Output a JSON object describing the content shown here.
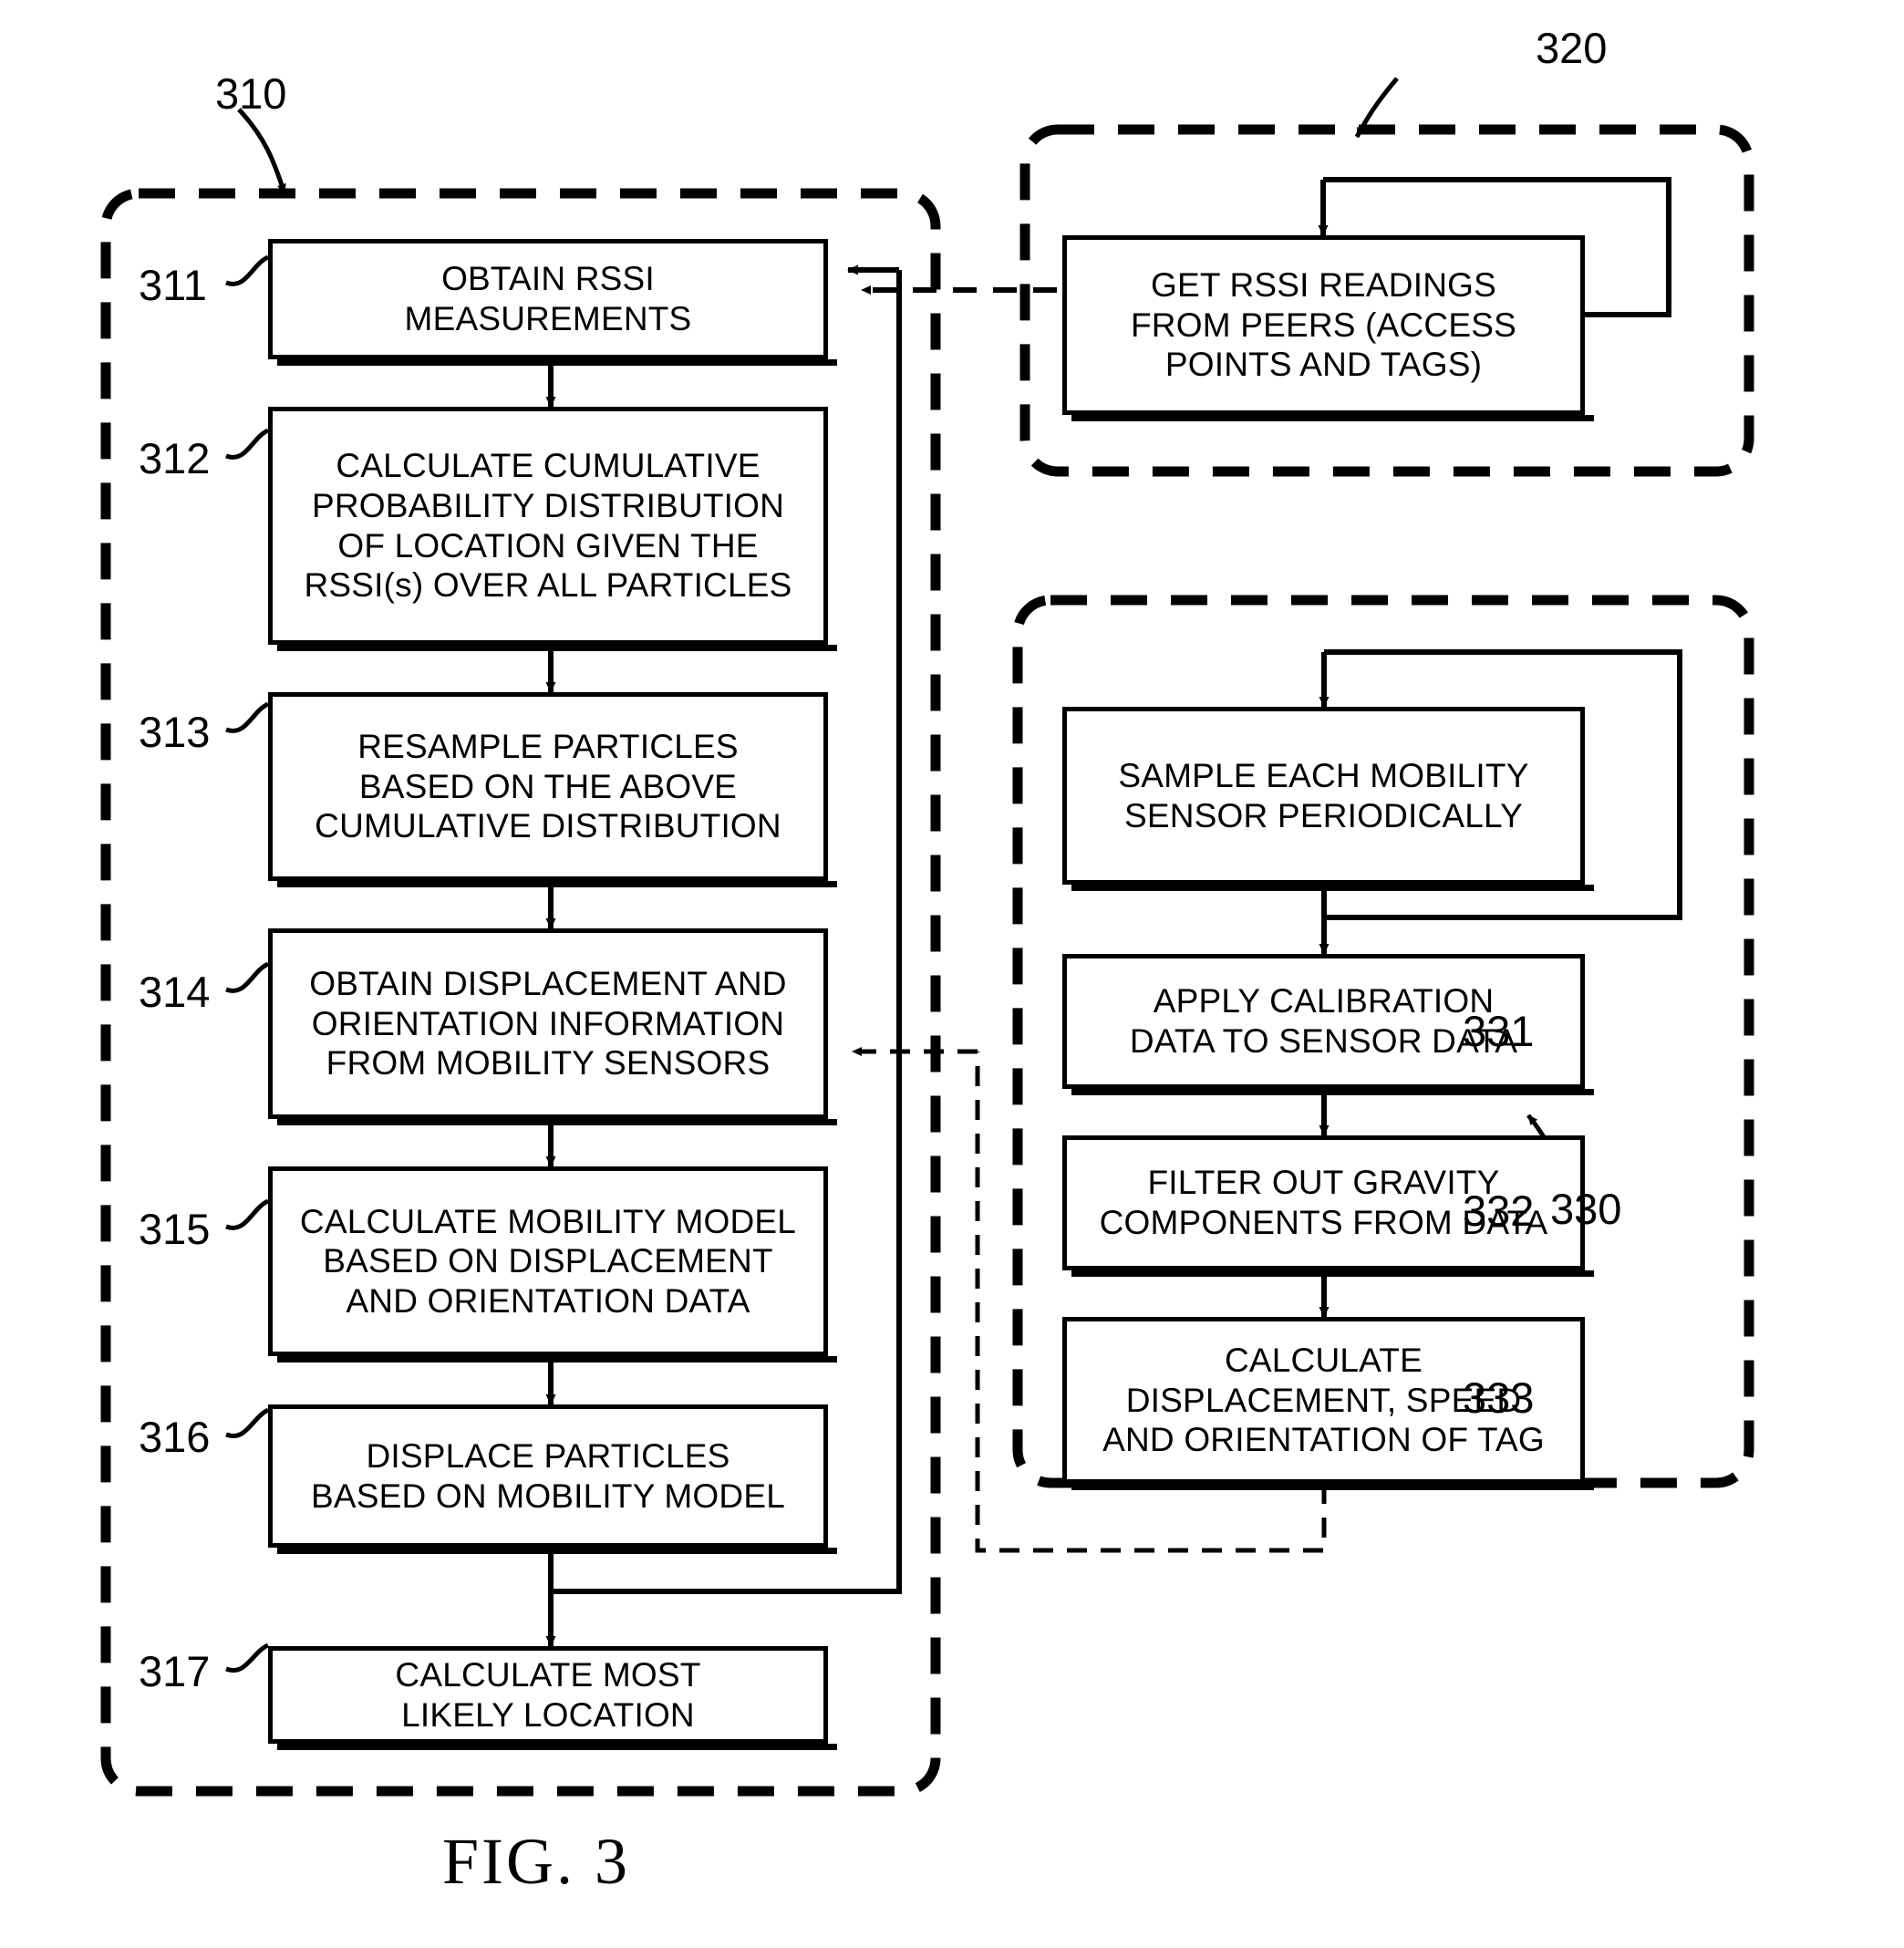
{
  "figure": {
    "caption": "FIG. 3"
  },
  "groups": [
    {
      "id": "310",
      "ref": "310",
      "name": "particle-filter-localization-group"
    },
    {
      "id": "320",
      "ref": "320",
      "name": "rssi-acquisition-group"
    },
    {
      "id": "330",
      "ref": "330",
      "name": "mobility-sensor-processing-group"
    }
  ],
  "left_column": {
    "group_ref": "310",
    "steps": [
      {
        "ref": "311",
        "text": "OBTAIN RSSI\nMEASUREMENTS"
      },
      {
        "ref": "312",
        "text": "CALCULATE CUMULATIVE\nPROBABILITY DISTRIBUTION\nOF LOCATION GIVEN THE\nRSSI(s) OVER ALL PARTICLES"
      },
      {
        "ref": "313",
        "text": "RESAMPLE PARTICLES\nBASED ON THE ABOVE\nCUMULATIVE DISTRIBUTION"
      },
      {
        "ref": "314",
        "text": "OBTAIN DISPLACEMENT AND\nORIENTATION INFORMATION\nFROM MOBILITY SENSORS"
      },
      {
        "ref": "315",
        "text": "CALCULATE MOBILITY MODEL\nBASED ON DISPLACEMENT\nAND ORIENTATION DATA"
      },
      {
        "ref": "316",
        "text": "DISPLACE PARTICLES\nBASED ON MOBILITY MODEL"
      },
      {
        "ref": "317",
        "text": "CALCULATE MOST\nLIKELY LOCATION"
      }
    ]
  },
  "right_top": {
    "group_ref": "320",
    "steps": [
      {
        "ref": "",
        "text": "GET RSSI READINGS\nFROM PEERS (ACCESS\nPOINTS AND TAGS)"
      }
    ]
  },
  "right_bottom": {
    "group_ref": "330",
    "steps": [
      {
        "ref": "",
        "text": "SAMPLE EACH MOBILITY\nSENSOR PERIODICALLY"
      },
      {
        "ref": "331",
        "text": "APPLY CALIBRATION\nDATA TO SENSOR DATA"
      },
      {
        "ref": "332",
        "text": "FILTER OUT GRAVITY\nCOMPONENTS FROM DATA"
      },
      {
        "ref": "333",
        "text": "CALCULATE\nDISPLACEMENT, SPEED\nAND ORIENTATION OF TAG"
      }
    ]
  },
  "colors": {
    "stroke": "#000000",
    "background": "#ffffff"
  }
}
